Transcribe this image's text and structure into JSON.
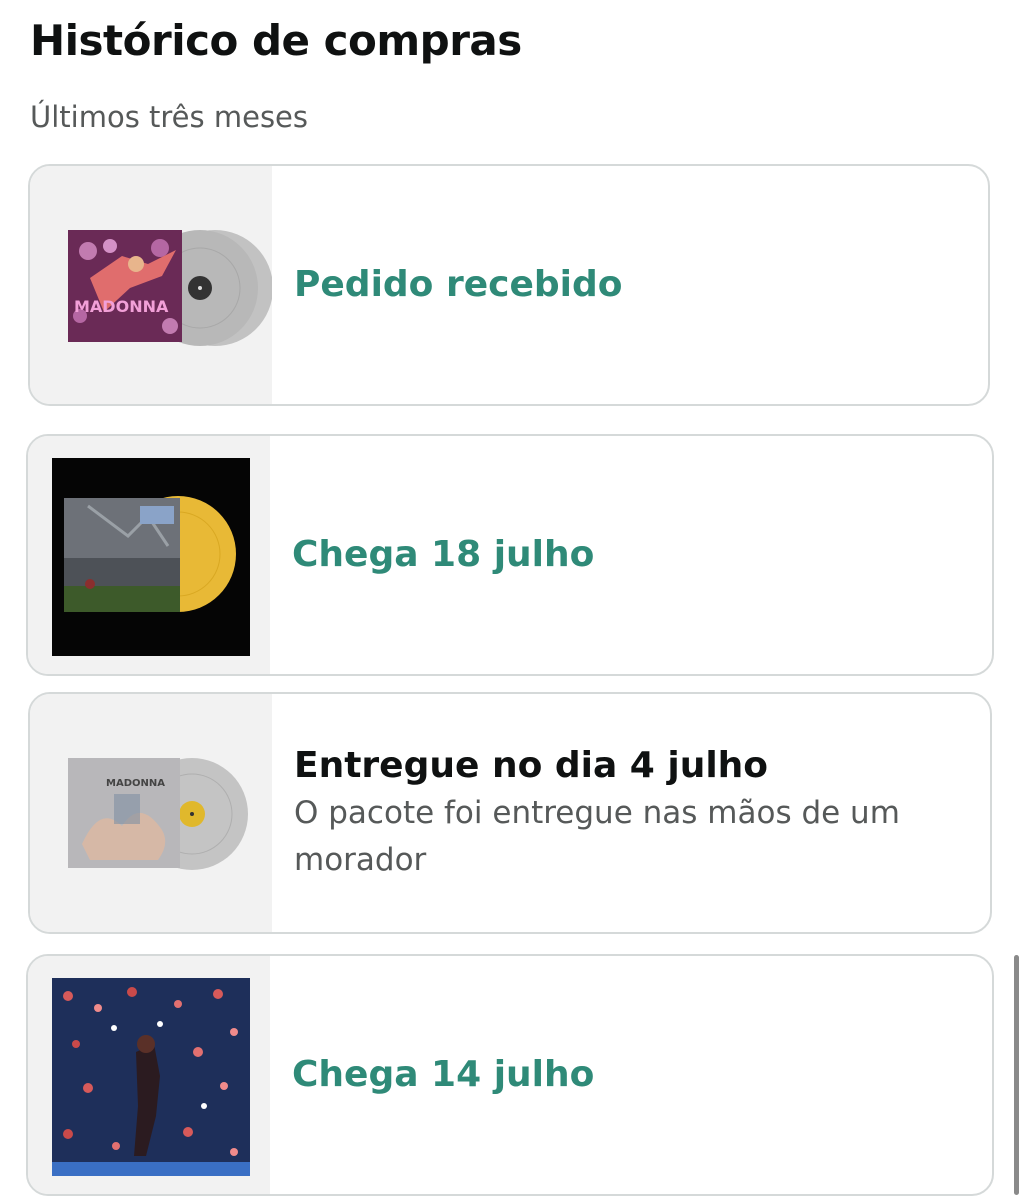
{
  "page": {
    "title": "Histórico de compras",
    "subtitle": "Últimos três meses"
  },
  "orders": [
    {
      "status": "Pedido recebido",
      "product_image": "vinyl-record-album-cover-icon",
      "album_cover_text": "MADONNA",
      "vinyl_color": "#bdbdbd"
    },
    {
      "status": "Chega 18 julho",
      "product_image": "vinyl-record-album-cover-icon",
      "vinyl_color": "#e8b936"
    },
    {
      "status": "Entregue no dia 4 julho",
      "detail": "O pacote foi entregue nas mãos de um morador",
      "product_image": "vinyl-record-album-cover-icon",
      "album_cover_text": "MADONNA",
      "vinyl_color": "#c4c4c4"
    },
    {
      "status": "Chega 14 julho",
      "product_image": "album-cover-icon"
    }
  ],
  "colors": {
    "status_accent": "#2f8a78",
    "delivered_text": "#0f1111",
    "secondary_text": "#565959",
    "card_border": "#d5d9d9"
  }
}
